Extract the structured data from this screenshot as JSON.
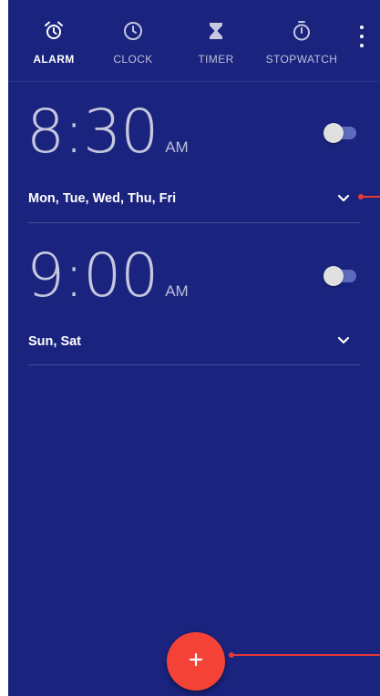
{
  "tabs": [
    {
      "label": "ALARM",
      "icon": "alarm-clock-icon",
      "active": true
    },
    {
      "label": "CLOCK",
      "icon": "clock-icon",
      "active": false
    },
    {
      "label": "TIMER",
      "icon": "hourglass-icon",
      "active": false
    },
    {
      "label": "STOPWATCH",
      "icon": "stopwatch-icon",
      "active": false
    }
  ],
  "overflow_icon": "more-vertical-icon",
  "alarms": [
    {
      "time": "8:30",
      "ampm": "AM",
      "days": "Mon, Tue, Wed, Thu, Fri",
      "enabled": false
    },
    {
      "time": "9:00",
      "ampm": "AM",
      "days": "Sun, Sat",
      "enabled": false
    }
  ],
  "fab": {
    "label": "+",
    "icon": "plus-icon"
  },
  "colors": {
    "background": "#1a237e",
    "fab": "#f44336",
    "toggle_track": "#5c6bc0",
    "toggle_thumb": "#e0e0e0",
    "annotation": "#e53935"
  }
}
